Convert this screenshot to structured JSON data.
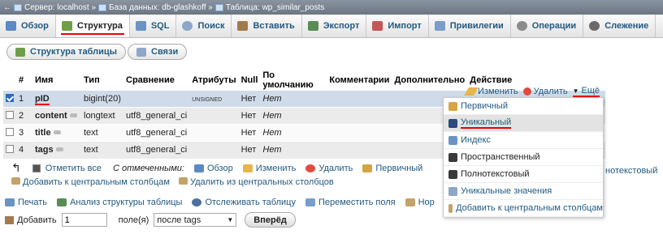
{
  "breadcrumb": {
    "arrow": "←",
    "server": "Сервер: localhost »",
    "database": "База данных: db-glashkoff »",
    "table": "Таблица: wp_similar_posts"
  },
  "tabs": [
    {
      "label": "Обзор",
      "active": false,
      "icon": "browse-icon",
      "color": "#5b8ac4"
    },
    {
      "label": "Структура",
      "active": true,
      "icon": "structure-icon",
      "color": "#6f9e4a"
    },
    {
      "label": "SQL",
      "active": false,
      "icon": "sql-icon",
      "color": "#6a93c4"
    },
    {
      "label": "Поиск",
      "active": false,
      "icon": "search-icon",
      "color": "#8ea7c6"
    },
    {
      "label": "Вставить",
      "active": false,
      "icon": "insert-icon",
      "color": "#a57a4a"
    },
    {
      "label": "Экспорт",
      "active": false,
      "icon": "export-icon",
      "color": "#5a8c55"
    },
    {
      "label": "Импорт",
      "active": false,
      "icon": "import-icon",
      "color": "#c45656"
    },
    {
      "label": "Привилегии",
      "active": false,
      "icon": "privileges-icon",
      "color": "#7a9dcc"
    },
    {
      "label": "Операции",
      "active": false,
      "icon": "operations-icon",
      "color": "#8c8c8c"
    },
    {
      "label": "Слежение",
      "active": false,
      "icon": "tracking-icon",
      "color": "#6a6a6a"
    }
  ],
  "subtabs": {
    "structure": "Структура таблицы",
    "relations": "Связи"
  },
  "columns": [
    "#",
    "Имя",
    "Тип",
    "Сравнение",
    "Атрибуты",
    "Null",
    "По умолчанию",
    "Комментарии",
    "Дополнительно",
    "Действие"
  ],
  "rows": [
    {
      "num": "1",
      "name": "pID",
      "type": "bigint(20)",
      "collation": "",
      "attributes": "UNSIGNED",
      "null": "Нет",
      "default": "Нет",
      "checked": true
    },
    {
      "num": "2",
      "name": "content",
      "type": "longtext",
      "collation": "utf8_general_ci",
      "attributes": "",
      "null": "Нет",
      "default": "Нет",
      "checked": false
    },
    {
      "num": "3",
      "name": "title",
      "type": "text",
      "collation": "utf8_general_ci",
      "attributes": "",
      "null": "Нет",
      "default": "Нет",
      "checked": false
    },
    {
      "num": "4",
      "name": "tags",
      "type": "text",
      "collation": "utf8_general_ci",
      "attributes": "",
      "null": "Нет",
      "default": "Нет",
      "checked": false
    }
  ],
  "row_actions": {
    "edit": "Изменить",
    "delete": "Удалить",
    "more": "Ещё"
  },
  "dropdown": [
    {
      "label": "Первичный",
      "icon": "primary-key-icon",
      "color": "#d4a640",
      "highlight": false,
      "disabled": false
    },
    {
      "label": "Уникальный",
      "icon": "unique-icon",
      "color": "#2c4a7a",
      "highlight": true,
      "disabled": false
    },
    {
      "label": "Индекс",
      "icon": "index-icon",
      "color": "#6a93c4",
      "highlight": false,
      "disabled": false
    },
    {
      "label": "Пространственный",
      "icon": "spatial-icon",
      "color": "#3a3a3a",
      "highlight": false,
      "disabled": true
    },
    {
      "label": "Полнотекстовый",
      "icon": "fulltext-icon",
      "color": "#3a3a3a",
      "highlight": false,
      "disabled": true
    },
    {
      "label": "Уникальные значения",
      "icon": "distinct-values-icon",
      "color": "#8ea7c6",
      "highlight": false,
      "disabled": false
    },
    {
      "label": "Добавить к центральным столбцам",
      "icon": "central-columns-icon",
      "color": "#c3a36a",
      "highlight": false,
      "disabled": false
    }
  ],
  "bulk": {
    "check_all": "Отметить все",
    "with_selected": "С отмеченными:",
    "browse": "Обзор",
    "edit": "Изменить",
    "delete": "Удалить",
    "primary": "Первичный",
    "fulltext_right": "нотекстовый",
    "add_central": "Добавить к центральным столбцам",
    "remove_central": "Удалить из центральных столбцов"
  },
  "bottom_links": {
    "print": "Печать",
    "analyze": "Анализ структуры таблицы",
    "track": "Отслеживать таблицу",
    "move": "Переместить поля",
    "normalize": "Нор"
  },
  "add_row": {
    "label": "Добавить",
    "count": "1",
    "fields_label": "поле(я)",
    "position": "после tags",
    "go": "Вперёд"
  }
}
